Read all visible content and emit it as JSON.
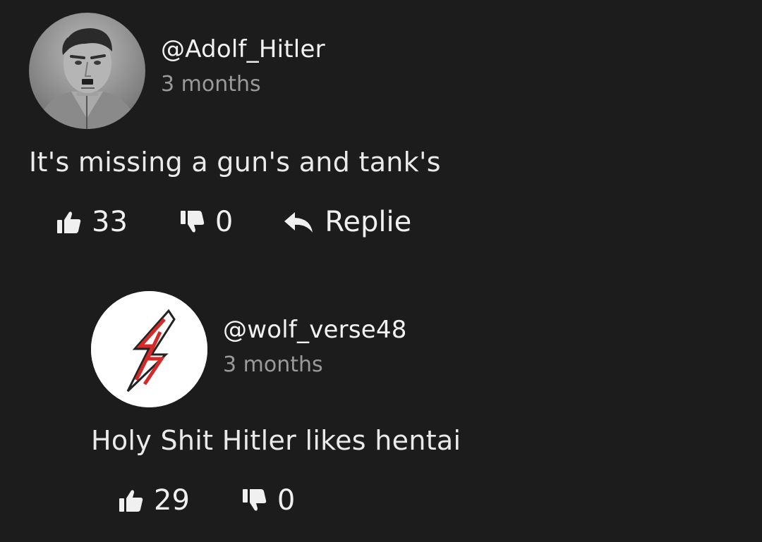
{
  "comments": [
    {
      "username": "@Adolf_Hitler",
      "time": "3 months",
      "text": "It's missing a gun's and tank's",
      "likes": "33",
      "dislikes": "0",
      "reply_label": "Replie",
      "avatar_icon": "portrait-photo"
    },
    {
      "username": "@wolf_verse48",
      "time": "3 months",
      "text": "Holy Shit Hitler likes hentai",
      "likes": "29",
      "dislikes": "0",
      "avatar_icon": "red-lightning-logo"
    }
  ],
  "colors": {
    "background": "#1c1c1c",
    "text": "#ececec",
    "muted": "#9a9a9a",
    "logo_red": "#d42a2a"
  }
}
